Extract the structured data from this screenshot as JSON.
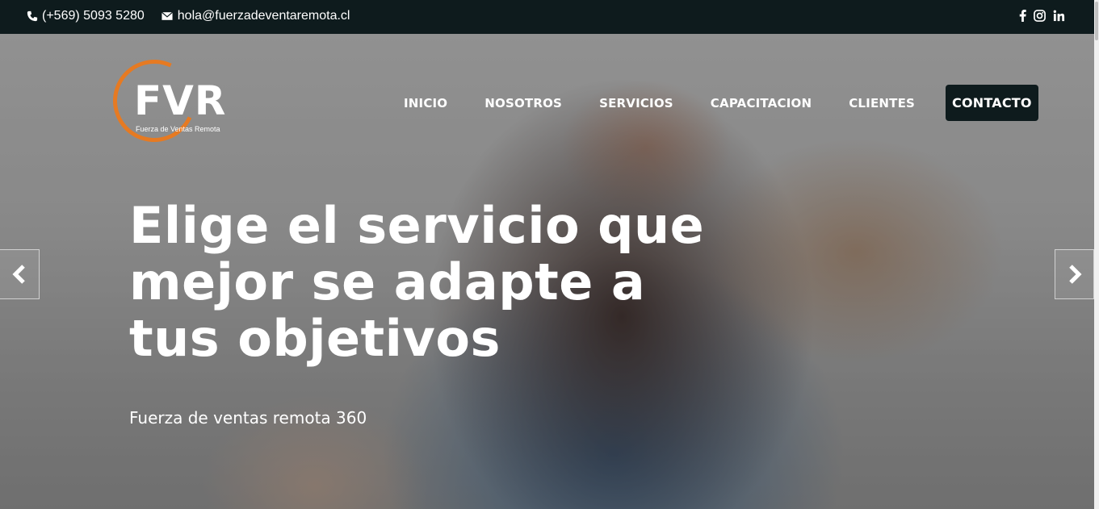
{
  "topbar": {
    "phone": "(+569) 5093 5280",
    "email": "hola@fuerzadeventaremota.cl",
    "social_icons": [
      "facebook-icon",
      "instagram-icon",
      "linkedin-icon"
    ]
  },
  "logo": {
    "mark": "FVR",
    "tagline": "Fuerza de Ventas Remota",
    "accent": "#e67a22"
  },
  "nav": {
    "items": [
      "INICIO",
      "NOSOTROS",
      "SERVICIOS",
      "CAPACITACION",
      "CLIENTES"
    ],
    "cta": "CONTACTO"
  },
  "hero": {
    "headline": "Elige el servicio que mejor se adapte a tus objetivos",
    "subheadline": "Fuerza de ventas remota 360",
    "prev_icon": "chevron-left-icon",
    "next_icon": "chevron-right-icon"
  },
  "colors": {
    "topbar_bg": "#0e1b1d",
    "cta_bg": "#0e1b1d",
    "text": "#ffffff"
  }
}
